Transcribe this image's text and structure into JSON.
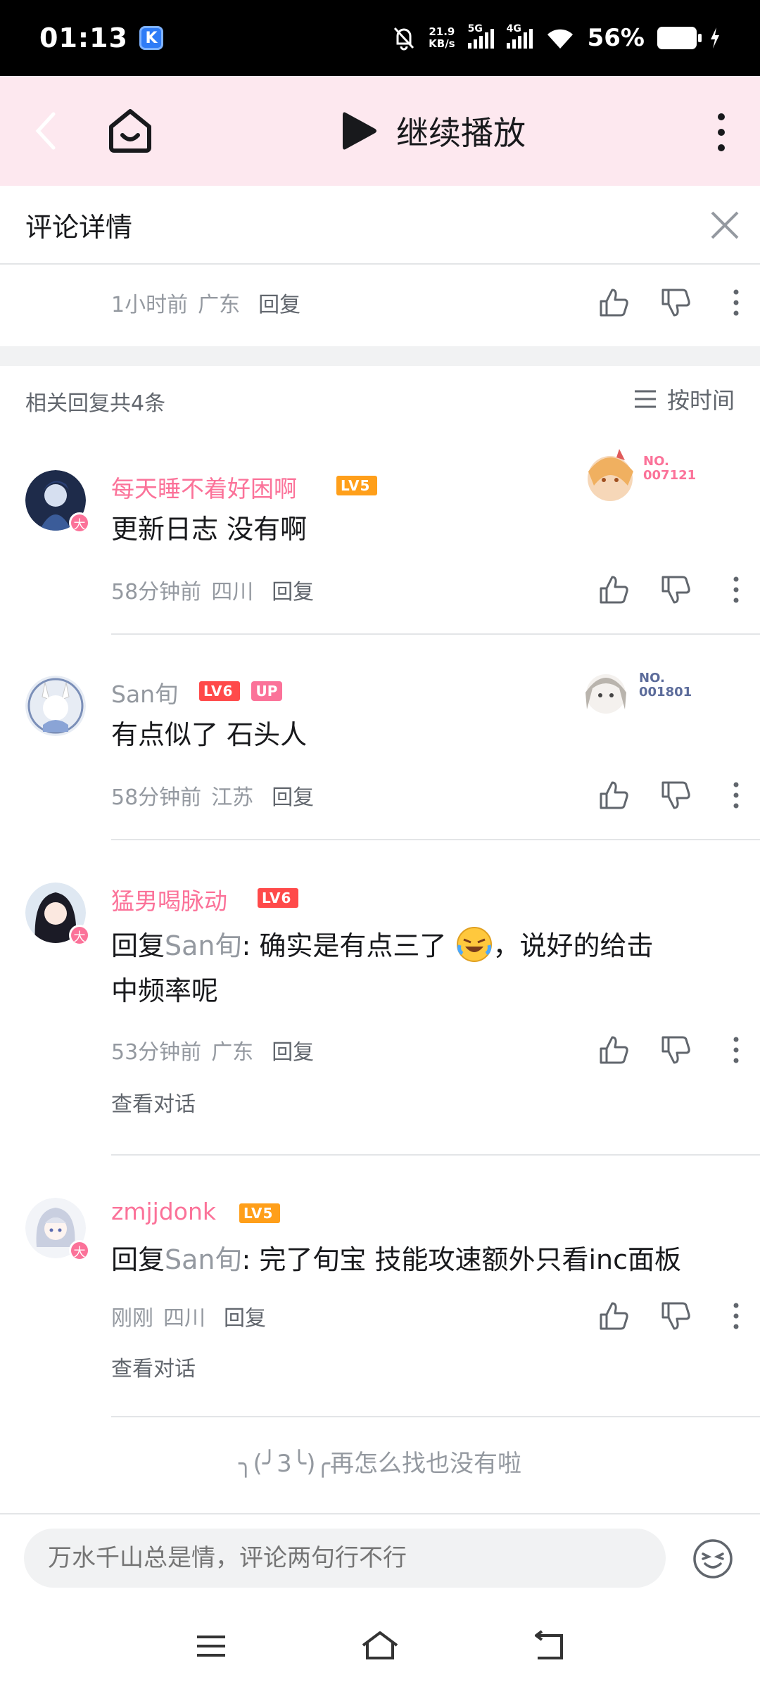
{
  "status_bar": {
    "time": "01:13",
    "app_badge": "K",
    "net_speed_value": "21.9",
    "net_speed_unit": "KB/s",
    "sim1": "5G",
    "sim2": "4G",
    "battery": "56%"
  },
  "app_bar": {
    "continue_label": "继续播放"
  },
  "detail": {
    "title": "评论详情"
  },
  "parent_meta": {
    "time": "1小时前",
    "location": "广东",
    "reply": "回复"
  },
  "replies": {
    "count_label": "相关回复共4条",
    "sort_label": "按时间",
    "end_hint": "╮(╯3╰)╭再怎么找也没有啦"
  },
  "comments": [
    {
      "username": "每天睡不着好困啊",
      "level": "LV5",
      "text": "更新日志 没有啊",
      "time": "58分钟前",
      "location": "四川",
      "reply": "回复",
      "medal_no_1": "NO.",
      "medal_no_2": "007121",
      "avatar_tag": "大"
    },
    {
      "username": "San旬",
      "level": "LV6",
      "up_tag": "UP",
      "text": "有点似了 石头人",
      "time": "58分钟前",
      "location": "江苏",
      "reply": "回复",
      "medal_no_1": "NO.",
      "medal_no_2": "001801"
    },
    {
      "username": "猛男喝脉动",
      "level": "LV6",
      "reply_prefix": "回复",
      "reply_to": "San旬",
      "text_line1": ": 确实是有点三了",
      "text_line1b": "，说好的给击",
      "text_line2": "中频率呢",
      "time": "53分钟前",
      "location": "广东",
      "reply": "回复",
      "view_conversation": "查看对话",
      "avatar_tag": "大"
    },
    {
      "username": "zmjjdonk",
      "level": "LV5",
      "reply_prefix": "回复",
      "reply_to": "San旬",
      "text": ": 完了旬宝 技能攻速额外只看inc面板",
      "time": "刚刚",
      "location": "四川",
      "reply": "回复",
      "view_conversation": "查看对话",
      "avatar_tag": "大"
    }
  ],
  "input": {
    "placeholder": "万水千山总是情，评论两句行不行"
  },
  "colors": {
    "accent_pink": "#fb7299",
    "app_bar_bg": "#fde8ef",
    "lv5": "#ff9f1a",
    "lv6": "#ff4a4a"
  }
}
